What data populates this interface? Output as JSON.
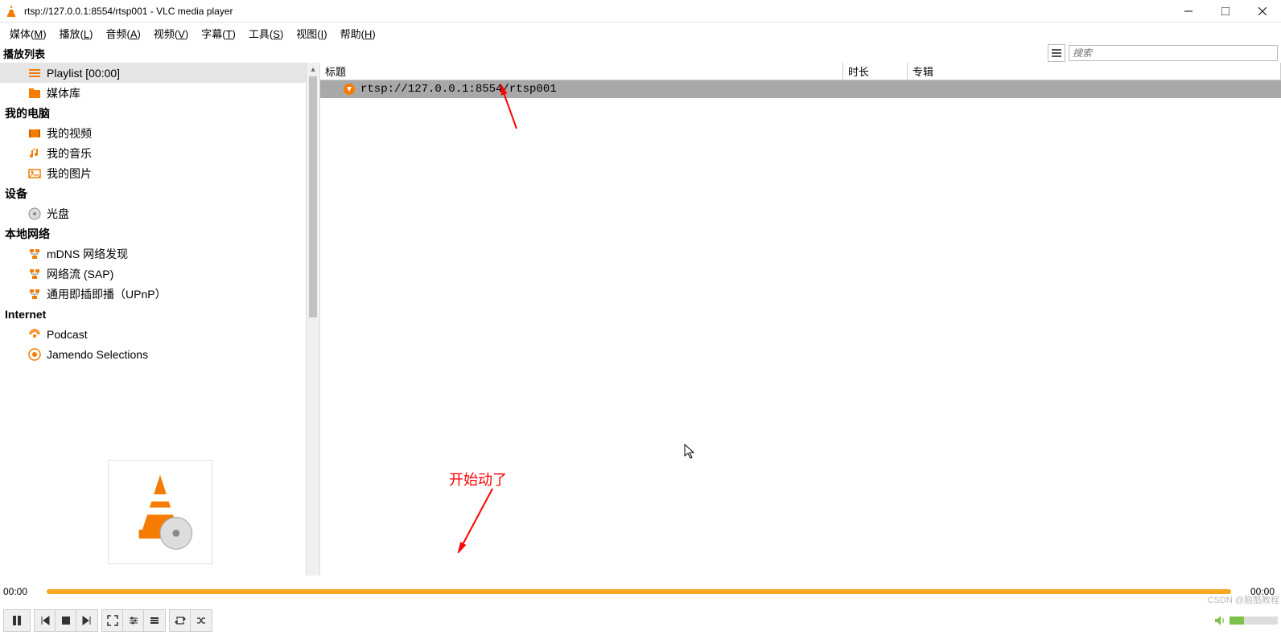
{
  "window": {
    "title": "rtsp://127.0.0.1:8554/rtsp001 - VLC media player"
  },
  "menu": {
    "items": [
      {
        "label": "媒体",
        "key": "M"
      },
      {
        "label": "播放",
        "key": "L"
      },
      {
        "label": "音频",
        "key": "A"
      },
      {
        "label": "视频",
        "key": "V"
      },
      {
        "label": "字幕",
        "key": "T"
      },
      {
        "label": "工具",
        "key": "S"
      },
      {
        "label": "视图",
        "key": "I"
      },
      {
        "label": "帮助",
        "key": "H"
      }
    ]
  },
  "playlist_header": {
    "label": "播放列表",
    "search_placeholder": "搜索"
  },
  "sidebar": {
    "items": [
      {
        "label": "Playlist [00:00]",
        "icon": "playlist",
        "selected": true,
        "indent": true
      },
      {
        "label": "媒体库",
        "icon": "medialib",
        "indent": true
      },
      {
        "label": "我的电脑",
        "header": true
      },
      {
        "label": "我的视频",
        "icon": "video",
        "indent": true
      },
      {
        "label": "我的音乐",
        "icon": "music",
        "indent": true
      },
      {
        "label": "我的图片",
        "icon": "pictures",
        "indent": true
      },
      {
        "label": "设备",
        "header": true
      },
      {
        "label": "光盘",
        "icon": "disc",
        "indent": true
      },
      {
        "label": "本地网络",
        "header": true
      },
      {
        "label": "mDNS 网络发现",
        "icon": "network",
        "indent": true
      },
      {
        "label": "网络流 (SAP)",
        "icon": "network",
        "indent": true
      },
      {
        "label": "通用即插即播（UPnP）",
        "icon": "network",
        "indent": true
      },
      {
        "label": "Internet",
        "header": true
      },
      {
        "label": "Podcast",
        "icon": "podcast",
        "indent": true
      },
      {
        "label": "Jamendo Selections",
        "icon": "jamendo",
        "indent": true
      }
    ]
  },
  "columns": {
    "title": "标题",
    "duration": "时长",
    "album": "专辑"
  },
  "playlist": {
    "rows": [
      {
        "title": "rtsp://127.0.0.1:8554/rtsp001"
      }
    ]
  },
  "annotation": {
    "text": "开始动了"
  },
  "progress": {
    "left": "00:00",
    "right": "00:00"
  },
  "watermark": "CSDN @脑酷教程",
  "icons": {
    "playlist": "playlist-icon",
    "medialib": "folder-icon",
    "video": "video-icon",
    "music": "music-icon",
    "pictures": "picture-icon",
    "disc": "disc-icon",
    "network": "network-icon",
    "podcast": "podcast-icon",
    "jamendo": "jamendo-icon"
  }
}
